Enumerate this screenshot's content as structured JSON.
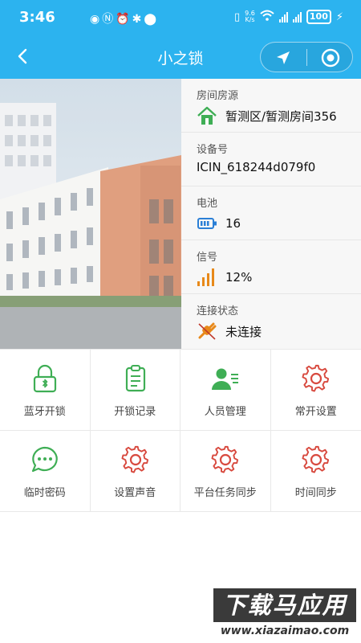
{
  "status_bar": {
    "time": "3:46",
    "network_speed_value": "9.6",
    "network_speed_unit": "K/s",
    "battery": "100"
  },
  "header": {
    "title": "小之锁"
  },
  "info": {
    "room_label": "房间房源",
    "room_value": "暂测区/暂测房间356",
    "device_label": "设备号",
    "device_value": "ICIN_618244d079f0",
    "battery_label": "电池",
    "battery_value": "16",
    "signal_label": "信号",
    "signal_value": "12%",
    "connection_label": "连接状态",
    "connection_value": "未连接"
  },
  "grid": {
    "items": [
      {
        "label": "蓝牙开锁",
        "icon": "bluetooth-unlock-icon"
      },
      {
        "label": "开锁记录",
        "icon": "clipboard-icon"
      },
      {
        "label": "人员管理",
        "icon": "person-card-icon"
      },
      {
        "label": "常开设置",
        "icon": "gear-icon"
      },
      {
        "label": "临时密码",
        "icon": "chat-bubble-icon"
      },
      {
        "label": "设置声音",
        "icon": "gear-icon"
      },
      {
        "label": "平台任务同步",
        "icon": "gear-icon"
      },
      {
        "label": "时间同步",
        "icon": "gear-icon"
      }
    ]
  },
  "watermark": {
    "brand": "下载马应用",
    "url": "www.xiazaimao.com"
  },
  "colors": {
    "header_blue": "#2cb3ef",
    "green": "#3fae55",
    "red": "#d84a3f",
    "orange": "#e8891a"
  }
}
